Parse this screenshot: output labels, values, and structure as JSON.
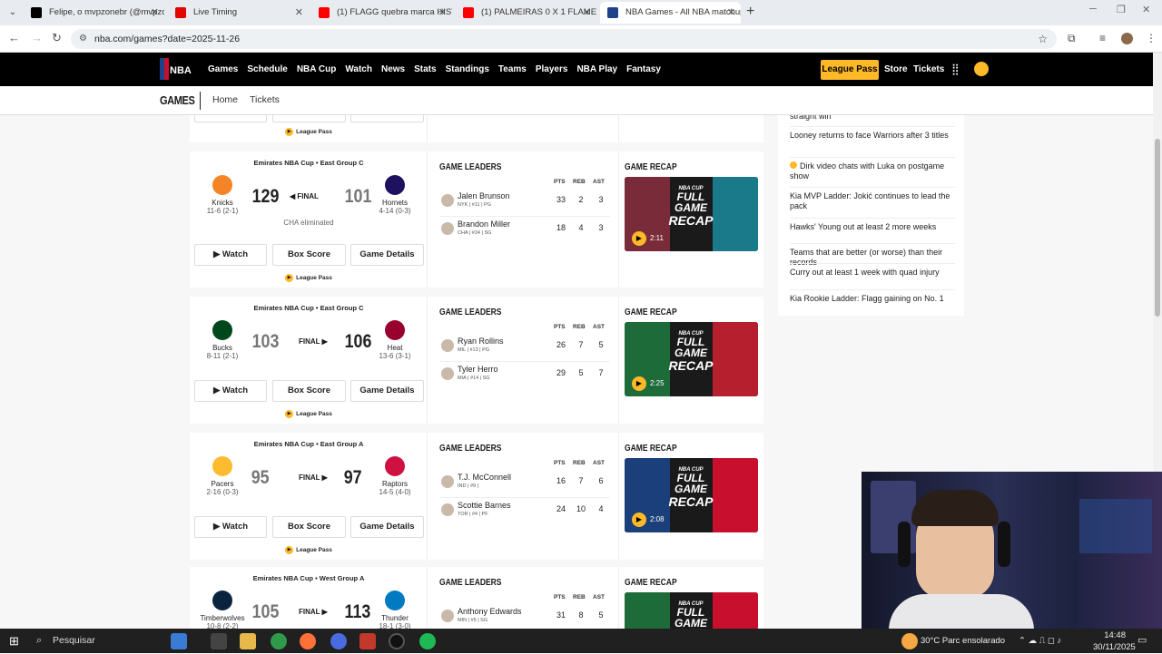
{
  "browser": {
    "tabs": [
      {
        "title": "Felipe, o mvpzonebr (@mvpzon",
        "color": "#000000"
      },
      {
        "title": "Live Timing",
        "color": "#e10600"
      },
      {
        "title": "(1) FLAGG quebra marca HISTÓ",
        "color": "#ff0000"
      },
      {
        "title": "(1) PALMEIRAS 0 X 1 FLAMENG",
        "color": "#ff0000"
      },
      {
        "title": "NBA Games - All NBA matchup",
        "color": "#1d428a"
      }
    ],
    "url": "nba.com/games?date=2025-11-26"
  },
  "nav": {
    "items": [
      "Games",
      "Schedule",
      "NBA Cup",
      "Watch",
      "News",
      "Stats",
      "Standings",
      "Teams",
      "Players",
      "NBA Play",
      "Fantasy"
    ],
    "league_pass": "League Pass",
    "store": "Store",
    "tickets": "Tickets"
  },
  "subnav": {
    "title": "GAMES",
    "home": "Home",
    "tickets": "Tickets"
  },
  "labels": {
    "watch": "Watch",
    "box_score": "Box Score",
    "game_details": "Game Details",
    "league_pass": "League Pass",
    "game_leaders": "GAME LEADERS",
    "game_recap": "GAME RECAP",
    "final": "FINAL",
    "pts": "PTS",
    "reb": "REB",
    "ast": "AST",
    "recap_top": "NBA CUP",
    "recap_full": "FULL GAME",
    "recap_word": "RECAP"
  },
  "games": [
    {
      "header": "Emirates NBA Cup • East Group C",
      "away": {
        "name": "Knicks",
        "record": "11-6 (2-1)",
        "score": "129",
        "color": "#f58426"
      },
      "home": {
        "name": "Hornets",
        "record": "4-14 (0-3)",
        "score": "101",
        "color": "#1d1160"
      },
      "winner": "away",
      "note": "CHA eliminated",
      "leaders": [
        {
          "name": "Jalen Brunson",
          "detail": "NYK | #11 | PG",
          "pts": "33",
          "reb": "2",
          "ast": "3"
        },
        {
          "name": "Brandon Miller",
          "detail": "CHA | #24 | SG",
          "pts": "18",
          "reb": "4",
          "ast": "3"
        }
      ],
      "recap_duration": "2:11",
      "recap_colors": [
        "#7a2b3a",
        "#1b7a8a"
      ]
    },
    {
      "header": "Emirates NBA Cup • East Group C",
      "away": {
        "name": "Bucks",
        "record": "8-11 (2-1)",
        "score": "103",
        "color": "#00471b"
      },
      "home": {
        "name": "Heat",
        "record": "13-6 (3-1)",
        "score": "106",
        "color": "#98002e"
      },
      "winner": "home",
      "note": "",
      "leaders": [
        {
          "name": "Ryan Rollins",
          "detail": "MIL | #13 | PG",
          "pts": "26",
          "reb": "7",
          "ast": "5"
        },
        {
          "name": "Tyler Herro",
          "detail": "MIA | #14 | SG",
          "pts": "29",
          "reb": "5",
          "ast": "7"
        }
      ],
      "recap_duration": "2:25",
      "recap_colors": [
        "#1e6b3a",
        "#b51f2e"
      ]
    },
    {
      "header": "Emirates NBA Cup • East Group A",
      "away": {
        "name": "Pacers",
        "record": "2-16 (0-3)",
        "score": "95",
        "color": "#fdbb30"
      },
      "home": {
        "name": "Raptors",
        "record": "14-5 (4-0)",
        "score": "97",
        "color": "#ce1141"
      },
      "winner": "home",
      "note": "",
      "leaders": [
        {
          "name": "T.J. McConnell",
          "detail": "IND | #9 |",
          "pts": "16",
          "reb": "7",
          "ast": "6"
        },
        {
          "name": "Scottie Barnes",
          "detail": "TOR | #4 | PF",
          "pts": "24",
          "reb": "10",
          "ast": "4"
        }
      ],
      "recap_duration": "2:08",
      "recap_colors": [
        "#1a3f7a",
        "#c8102e"
      ]
    },
    {
      "header": "Emirates NBA Cup • West Group A",
      "away": {
        "name": "Timberwolves",
        "record": "10-8 (2-2)",
        "score": "105",
        "color": "#0c2340"
      },
      "home": {
        "name": "Thunder",
        "record": "18-1 (3-0)",
        "score": "113",
        "color": "#007ac1"
      },
      "winner": "home",
      "note": "",
      "leaders": [
        {
          "name": "Anthony Edwards",
          "detail": "MIN | #5 | SG",
          "pts": "31",
          "reb": "8",
          "ast": "5"
        }
      ],
      "recap_duration": "",
      "recap_colors": [
        "#1e6b3a",
        "#c8102e"
      ]
    }
  ],
  "sidebar": {
    "headlines": [
      "straight win",
      "Looney returns to face Warriors after 3 titles",
      "Dirk video chats with Luka on postgame show",
      "Kia MVP Ladder: Jokić continues to lead the pack",
      "Hawks' Young out at least 2 more weeks",
      "Teams that are better (or worse) than their records",
      "Curry out at least 1 week with quad injury",
      "Kia Rookie Ladder: Flagg gaining on No. 1"
    ]
  },
  "taskbar": {
    "search": "Pesquisar",
    "weather": "30°C  Parc ensolarado",
    "time": "14:48",
    "date": "30/11/2025"
  }
}
